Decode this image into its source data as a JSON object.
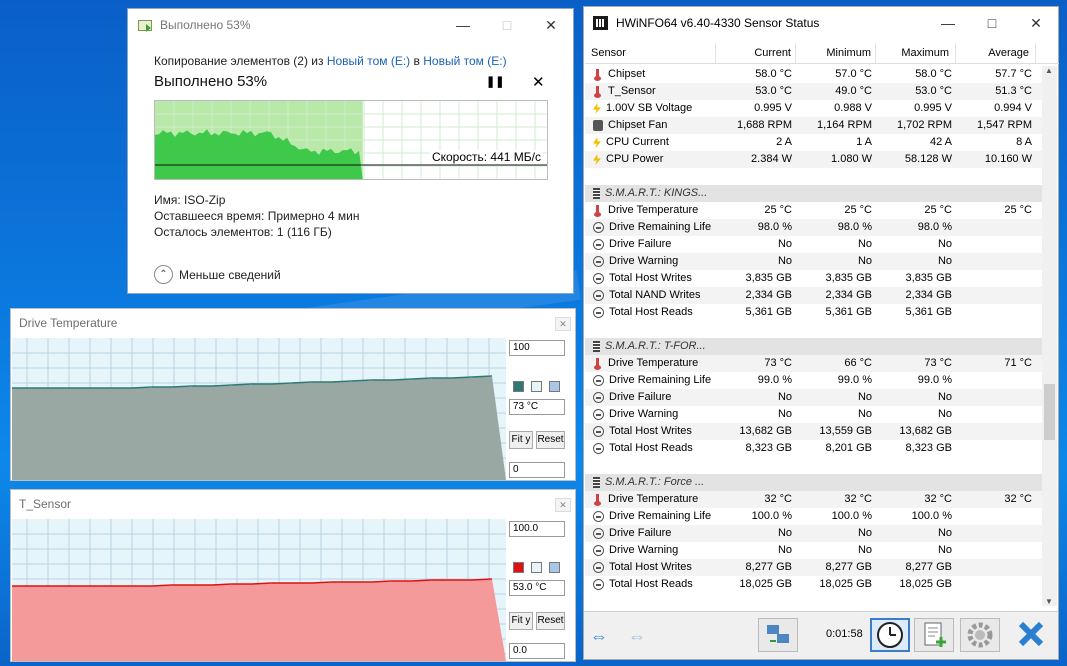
{
  "copy_dialog": {
    "title": "Выполнено 53%",
    "path_prefix": "Копирование элементов (2) из",
    "source": "Новый том (E:)",
    "path_mid": "в",
    "dest": "Новый том (E:)",
    "progress_text": "Выполнено 53%",
    "progress": 0.53,
    "speed": "Скорость: 441 МБ/с",
    "name_line": "Имя:  ISO-Zip",
    "time_line": "Оставшееся время:  Примерно 4 мин",
    "items_line": "Осталось элементов:  1 (116 ГБ)",
    "less_details": "Меньше сведений"
  },
  "graph1": {
    "title": "Drive Temperature",
    "max": "100",
    "current": "73 °C",
    "min": "0",
    "fit": "Fit y",
    "reset": "Reset",
    "fill_color": "#9aa8a4",
    "line_color": "#2e7a72"
  },
  "graph2": {
    "title": "T_Sensor",
    "max": "100.0",
    "current": "53.0 °C",
    "min": "0.0",
    "fit": "Fit y",
    "reset": "Reset",
    "fill_color": "#f59a9a",
    "line_color": "#dd1111"
  },
  "hwinfo": {
    "title": "HWiNFO64 v6.40-4330 Sensor Status",
    "columns": [
      "Sensor",
      "Current",
      "Minimum",
      "Maximum",
      "Average"
    ],
    "elapsed": "0:01:58",
    "rows": [
      {
        "type": "data",
        "icon": "thermo",
        "name": "Chipset",
        "cur": "58.0 °C",
        "min": "57.0 °C",
        "max": "58.0 °C",
        "avg": "57.7 °C"
      },
      {
        "type": "data",
        "icon": "thermo",
        "name": "T_Sensor",
        "cur": "53.0 °C",
        "min": "49.0 °C",
        "max": "53.0 °C",
        "avg": "51.3 °C"
      },
      {
        "type": "data",
        "icon": "bolt",
        "name": "1.00V SB Voltage",
        "cur": "0.995 V",
        "min": "0.988 V",
        "max": "0.995 V",
        "avg": "0.994 V"
      },
      {
        "type": "data",
        "icon": "fan",
        "name": "Chipset Fan",
        "cur": "1,688 RPM",
        "min": "1,164 RPM",
        "max": "1,702 RPM",
        "avg": "1,547 RPM"
      },
      {
        "type": "data",
        "icon": "bolt",
        "name": "CPU Current",
        "cur": "2 A",
        "min": "1 A",
        "max": "42 A",
        "avg": "8 A"
      },
      {
        "type": "data",
        "icon": "bolt",
        "name": "CPU Power",
        "cur": "2.384 W",
        "min": "1.080 W",
        "max": "58.128 W",
        "avg": "10.160 W"
      },
      {
        "type": "blank"
      },
      {
        "type": "sec",
        "name": "S.M.A.R.T.: KINGS..."
      },
      {
        "type": "data",
        "icon": "thermo",
        "name": "Drive Temperature",
        "cur": "25 °C",
        "min": "25 °C",
        "max": "25 °C",
        "avg": "25 °C"
      },
      {
        "type": "data",
        "icon": "circle",
        "name": "Drive Remaining Life",
        "cur": "98.0 %",
        "min": "98.0 %",
        "max": "98.0 %",
        "avg": ""
      },
      {
        "type": "data",
        "icon": "circle",
        "name": "Drive Failure",
        "cur": "No",
        "min": "No",
        "max": "No",
        "avg": ""
      },
      {
        "type": "data",
        "icon": "circle",
        "name": "Drive Warning",
        "cur": "No",
        "min": "No",
        "max": "No",
        "avg": ""
      },
      {
        "type": "data",
        "icon": "circle",
        "name": "Total Host Writes",
        "cur": "3,835 GB",
        "min": "3,835 GB",
        "max": "3,835 GB",
        "avg": ""
      },
      {
        "type": "data",
        "icon": "circle",
        "name": "Total NAND Writes",
        "cur": "2,334 GB",
        "min": "2,334 GB",
        "max": "2,334 GB",
        "avg": ""
      },
      {
        "type": "data",
        "icon": "circle",
        "name": "Total Host Reads",
        "cur": "5,361 GB",
        "min": "5,361 GB",
        "max": "5,361 GB",
        "avg": ""
      },
      {
        "type": "blank"
      },
      {
        "type": "sec",
        "name": "S.M.A.R.T.: T-FOR..."
      },
      {
        "type": "data",
        "icon": "thermo",
        "name": "Drive Temperature",
        "cur": "73 °C",
        "min": "66 °C",
        "max": "73 °C",
        "avg": "71 °C"
      },
      {
        "type": "data",
        "icon": "circle",
        "name": "Drive Remaining Life",
        "cur": "99.0 %",
        "min": "99.0 %",
        "max": "99.0 %",
        "avg": ""
      },
      {
        "type": "data",
        "icon": "circle",
        "name": "Drive Failure",
        "cur": "No",
        "min": "No",
        "max": "No",
        "avg": ""
      },
      {
        "type": "data",
        "icon": "circle",
        "name": "Drive Warning",
        "cur": "No",
        "min": "No",
        "max": "No",
        "avg": ""
      },
      {
        "type": "data",
        "icon": "circle",
        "name": "Total Host Writes",
        "cur": "13,682 GB",
        "min": "13,559 GB",
        "max": "13,682 GB",
        "avg": ""
      },
      {
        "type": "data",
        "icon": "circle",
        "name": "Total Host Reads",
        "cur": "8,323 GB",
        "min": "8,201 GB",
        "max": "8,323 GB",
        "avg": ""
      },
      {
        "type": "blank"
      },
      {
        "type": "sec",
        "name": "S.M.A.R.T.: Force ..."
      },
      {
        "type": "data",
        "icon": "thermo",
        "name": "Drive Temperature",
        "cur": "32 °C",
        "min": "32 °C",
        "max": "32 °C",
        "avg": "32 °C"
      },
      {
        "type": "data",
        "icon": "circle",
        "name": "Drive Remaining Life",
        "cur": "100.0 %",
        "min": "100.0 %",
        "max": "100.0 %",
        "avg": ""
      },
      {
        "type": "data",
        "icon": "circle",
        "name": "Drive Failure",
        "cur": "No",
        "min": "No",
        "max": "No",
        "avg": ""
      },
      {
        "type": "data",
        "icon": "circle",
        "name": "Drive Warning",
        "cur": "No",
        "min": "No",
        "max": "No",
        "avg": ""
      },
      {
        "type": "data",
        "icon": "circle",
        "name": "Total Host Writes",
        "cur": "8,277 GB",
        "min": "8,277 GB",
        "max": "8,277 GB",
        "avg": ""
      },
      {
        "type": "data",
        "icon": "circle",
        "name": "Total Host Reads",
        "cur": "18,025 GB",
        "min": "18,025 GB",
        "max": "18,025 GB",
        "avg": ""
      }
    ]
  }
}
